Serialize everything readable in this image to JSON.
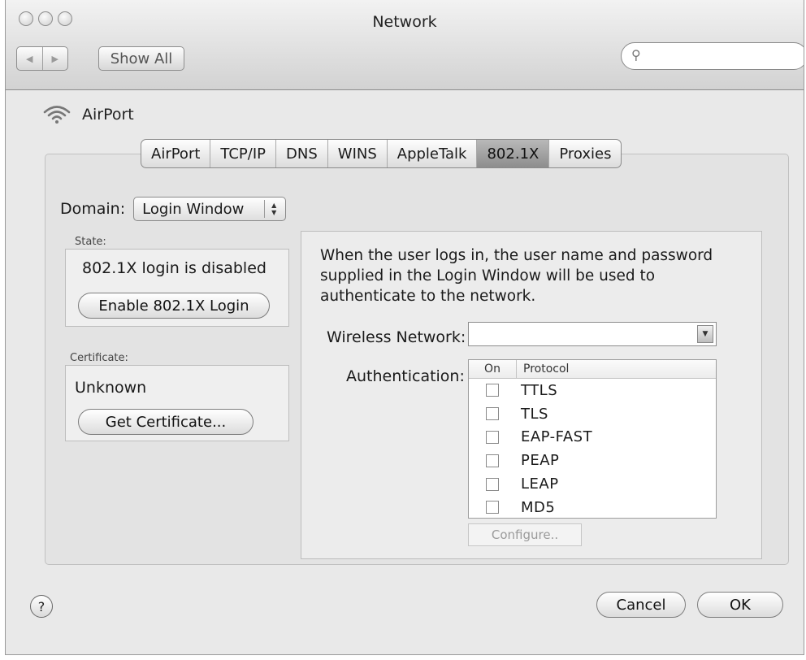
{
  "window": {
    "title": "Network"
  },
  "toolbar": {
    "back_glyph": "◀",
    "forward_glyph": "▶",
    "show_all_label": "Show All",
    "search_placeholder": "",
    "search_icon_glyph": "⚲"
  },
  "header": {
    "label": "AirPort"
  },
  "tabs": [
    {
      "label": "AirPort",
      "active": false
    },
    {
      "label": "TCP/IP",
      "active": false
    },
    {
      "label": "DNS",
      "active": false
    },
    {
      "label": "WINS",
      "active": false
    },
    {
      "label": "AppleTalk",
      "active": false
    },
    {
      "label": "802.1X",
      "active": true
    },
    {
      "label": "Proxies",
      "active": false
    }
  ],
  "domain": {
    "label": "Domain:",
    "value": "Login Window"
  },
  "state": {
    "section_label": "State:",
    "status_text": "802.1X login is disabled",
    "button_label": "Enable 802.1X Login"
  },
  "certificate": {
    "section_label": "Certificate:",
    "value": "Unknown",
    "button_label": "Get Certificate..."
  },
  "details": {
    "description": "When the user logs in, the user name and password supplied in the Login Window will be used to authenticate to the network.",
    "wireless_network_label": "Wireless Network:",
    "wireless_network_value": "",
    "authentication_label": "Authentication:",
    "auth_columns": {
      "on": "On",
      "protocol": "Protocol"
    },
    "protocols": [
      {
        "name": "TTLS",
        "on": false
      },
      {
        "name": "TLS",
        "on": false
      },
      {
        "name": "EAP-FAST",
        "on": false
      },
      {
        "name": "PEAP",
        "on": false
      },
      {
        "name": "LEAP",
        "on": false
      },
      {
        "name": "MD5",
        "on": false
      }
    ],
    "configure_label": "Configure.."
  },
  "footer": {
    "help_label": "?",
    "cancel_label": "Cancel",
    "ok_label": "OK"
  }
}
